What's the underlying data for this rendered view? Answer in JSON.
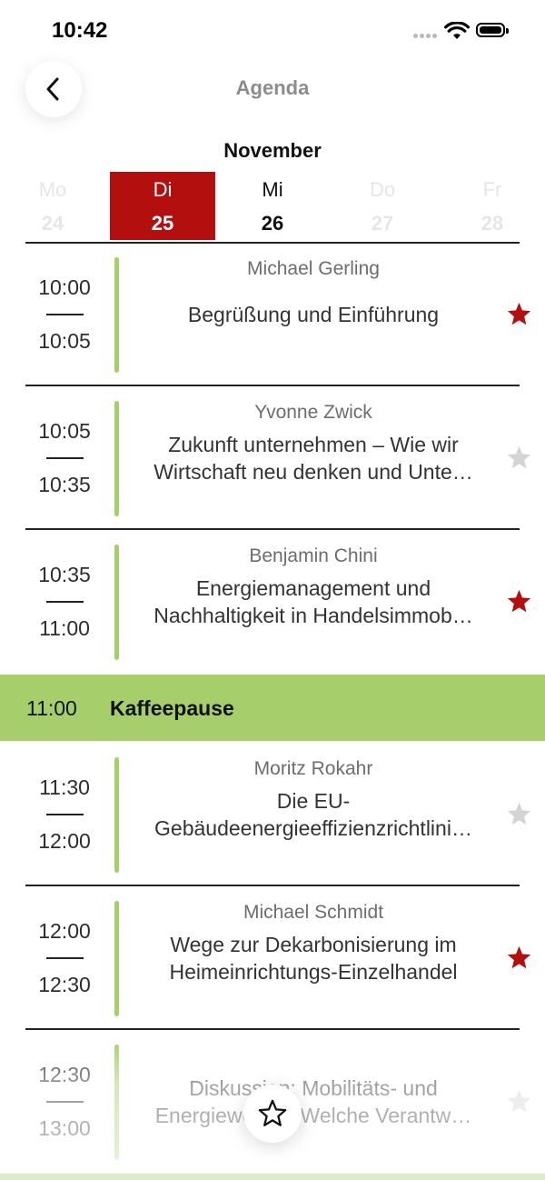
{
  "status_bar": {
    "time": "10:42"
  },
  "header": {
    "title": "Agenda",
    "back_icon": "chevron-left-icon"
  },
  "calendar": {
    "month": "November",
    "days": [
      {
        "name": "Mo",
        "num": "24",
        "state": "inactive"
      },
      {
        "name": "Di",
        "num": "25",
        "state": "active"
      },
      {
        "name": "Mi",
        "num": "26",
        "state": "normal"
      },
      {
        "name": "Do",
        "num": "27",
        "state": "inactive"
      },
      {
        "name": "Fr",
        "num": "28",
        "state": "inactive"
      }
    ]
  },
  "sessions": [
    {
      "start": "10:00",
      "end": "10:05",
      "speaker": "Michael Gerling",
      "title_lines": [
        "Begrüßung und Einführung"
      ],
      "favorite": true
    },
    {
      "start": "10:05",
      "end": "10:35",
      "speaker": "Yvonne Zwick",
      "title_lines": [
        "Zukunft unternehmen – Wie wir",
        "Wirtschaft neu denken und Unte…"
      ],
      "favorite": false
    },
    {
      "start": "10:35",
      "end": "11:00",
      "speaker": "Benjamin Chini",
      "title_lines": [
        "Energiemanagement und",
        "Nachhaltigkeit in Handelsimmob…"
      ],
      "favorite": true
    },
    {
      "start": "11:30",
      "end": "12:00",
      "speaker": "Moritz Rokahr",
      "title_lines": [
        "Die EU-",
        "Gebäudeenergieeffizienzrichtlini…"
      ],
      "favorite": false
    },
    {
      "start": "12:00",
      "end": "12:30",
      "speaker": "Michael Schmidt",
      "title_lines": [
        "Wege zur Dekarbonisierung im",
        "Heimeinrichtungs-Einzelhandel"
      ],
      "favorite": true
    },
    {
      "start": "12:30",
      "end": "13:00",
      "speaker": "",
      "title_lines": [
        "Diskussion: Mobilitäts- und",
        "Energiewende: Welche Verantw…"
      ],
      "favorite": false
    }
  ],
  "break": {
    "time": "11:00",
    "title": "Kaffeepause"
  },
  "fab": {
    "icon": "star-outline-icon"
  },
  "colors": {
    "accent_red": "#b30f0f",
    "accent_green": "#a6cf6c",
    "star_inactive": "#d4d4d4"
  }
}
